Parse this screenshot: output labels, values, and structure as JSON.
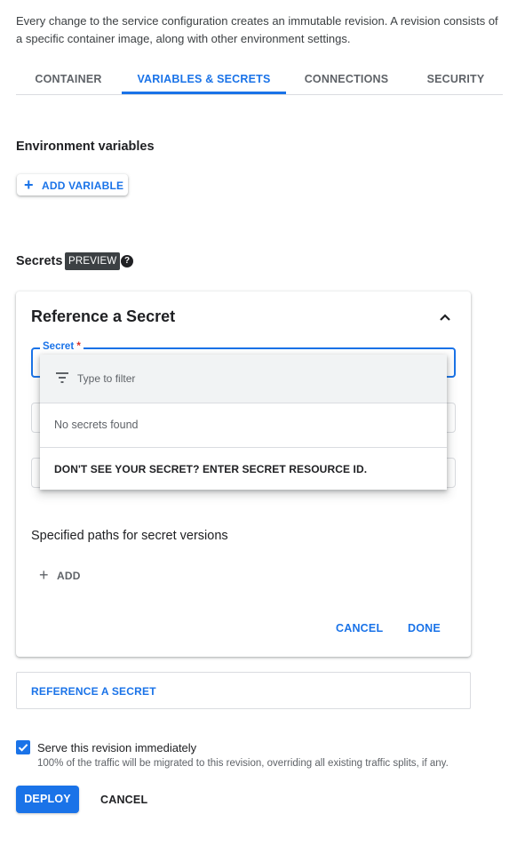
{
  "intro": {
    "text": "Every change to the service configuration creates an immutable revision. A revision consists of a specific container image, along with other environment settings."
  },
  "tabs": [
    {
      "label": "CONTAINER",
      "active": false
    },
    {
      "label": "VARIABLES & SECRETS",
      "active": true
    },
    {
      "label": "CONNECTIONS",
      "active": false
    },
    {
      "label": "SECURITY",
      "active": false
    }
  ],
  "env": {
    "title": "Environment variables",
    "add_label": "ADD VARIABLE"
  },
  "secrets": {
    "title": "Secrets",
    "badge": "PREVIEW",
    "help_icon": "help-circle-icon"
  },
  "card": {
    "title": "Reference a Secret",
    "secret_field": {
      "label": "Secret",
      "required_mark": "*",
      "value": ""
    },
    "paths_title": "Specified paths for secret versions",
    "add_label": "ADD",
    "cancel_label": "CANCEL",
    "done_label": "DONE"
  },
  "dropdown": {
    "filter_placeholder": "Type to filter",
    "empty_text": "No secrets found",
    "action_label": "DON'T SEE YOUR SECRET? ENTER SECRET RESOURCE ID."
  },
  "reference_secret": {
    "label": "REFERENCE A SECRET"
  },
  "serve": {
    "checked": true,
    "label": "Serve this revision immediately",
    "sub": "100% of the traffic will be migrated to this revision, overriding all existing traffic splits, if any."
  },
  "footer": {
    "deploy_label": "DEPLOY",
    "cancel_label": "CANCEL"
  },
  "colors": {
    "accent": "#1a73e8",
    "badge_bg": "#3c4043",
    "required": "#d93025"
  }
}
